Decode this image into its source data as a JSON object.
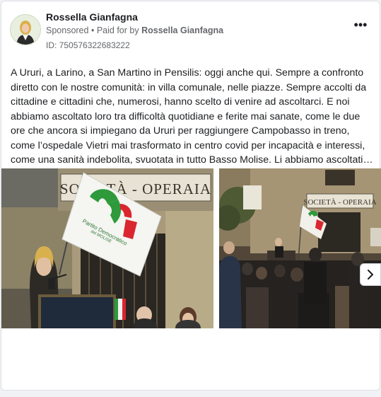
{
  "post": {
    "author": "Rossella Gianfagna",
    "sponsored_label": "Sponsored",
    "separator": "•",
    "paid_for_prefix": "Paid for by",
    "paid_for_name": "Rossella Gianfagna",
    "ad_id": "ID: 750576322683222",
    "more_label": "•••",
    "text": "A Ururi, a Larino, a San Martino in Pensilis: oggi anche qui. Sempre a confronto diretto con le nostre comunità: in villa comunale, nelle piazze. Sempre accolti da cittadine e cittadini che, numerosi, hanno scelto di venire ad ascoltarci. E noi abbiamo ascoltato loro tra difficoltà quotidiane e ferite mai sanate, come le due ore che ancora si impiegano da Ururi per raggiungere Campobasso in treno, come l’ospedale Vietri mai trasformato in centro covid per incapacità e interessi, come una sanità indebolita, svuotata in tutto Basso Molise. Li abbiamo ascoltati, i nostri"
  },
  "media": {
    "image1": {
      "sign_text": "SOCIETÀ - OPERAIA",
      "flag_party": "Partito Democratico",
      "flag_sub": "del MOLISE"
    },
    "image2": {
      "sign_text": "SOCIETÀ - OPERAIA"
    }
  },
  "colors": {
    "pd_green": "#2e9a3c",
    "pd_red": "#d9262f",
    "meta_gray": "#65676b"
  },
  "icons": {
    "more": "more-icon",
    "next": "chevron-right-icon"
  }
}
